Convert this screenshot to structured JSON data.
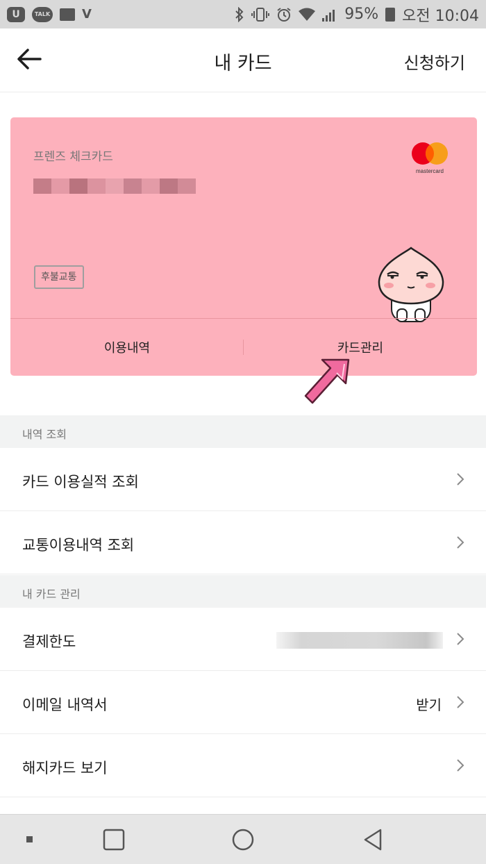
{
  "status_bar": {
    "left_icons": [
      "u-plus-icon",
      "kakaotalk-icon",
      "image-icon",
      "volte-icon"
    ],
    "talk_label": "TALK",
    "battery": "95%",
    "time": "오전 10:04"
  },
  "header": {
    "title": "내 카드",
    "action": "신청하기"
  },
  "card": {
    "name": "프렌즈 체크카드",
    "brand": "mastercard",
    "badge": "후불교통",
    "tabs": [
      "이용내역",
      "카드관리"
    ],
    "color": "#fdb1bc"
  },
  "sections": [
    {
      "title": "내역 조회",
      "items": [
        {
          "label": "카드 이용실적 조회",
          "value": ""
        },
        {
          "label": "교통이용내역 조회",
          "value": ""
        }
      ]
    },
    {
      "title": "내 카드 관리",
      "items": [
        {
          "label": "결제한도",
          "value": "원"
        },
        {
          "label": "이메일 내역서",
          "value": "받기"
        },
        {
          "label": "해지카드 보기",
          "value": ""
        }
      ]
    }
  ],
  "colors": {
    "arrow": "#f06a9e",
    "mastercard_red": "#eb001b",
    "mastercard_orange": "#f79e1b"
  }
}
